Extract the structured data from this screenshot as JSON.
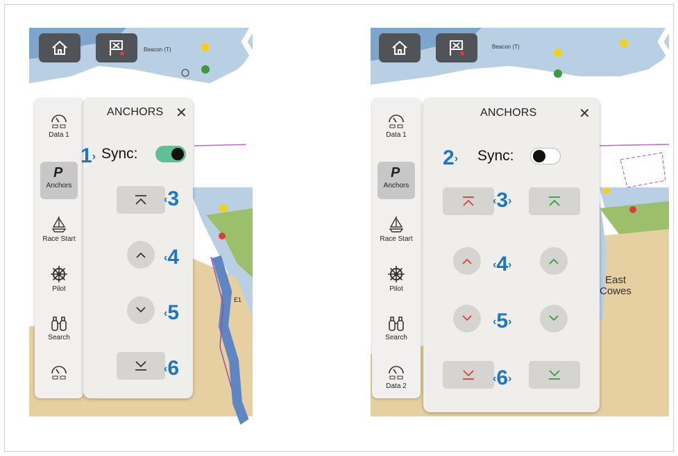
{
  "colors": {
    "callout": "#1b77c4",
    "toggle_on": "#5fc095",
    "port_red": "#e03a3a",
    "starboard_green": "#2f9e3a",
    "water": "#b9cfe4",
    "land": "#e6cfa0"
  },
  "left": {
    "sidebar": [
      {
        "label": "Data 1",
        "icon": "gauge-icon"
      },
      {
        "label": "Anchors",
        "icon": "anchor-p-icon",
        "active": true
      },
      {
        "label": "Race Start",
        "icon": "sailboat-icon"
      },
      {
        "label": "Pilot",
        "icon": "helm-wheel-icon"
      },
      {
        "label": "Search",
        "icon": "binoculars-icon"
      },
      {
        "label": "",
        "icon": "gauge-icon"
      }
    ],
    "panel": {
      "title": "ANCHORS",
      "close": "✕",
      "sync_label": "Sync:",
      "sync_on": true
    },
    "callouts": [
      "1",
      "3",
      "4",
      "5",
      "6"
    ]
  },
  "right": {
    "sidebar": [
      {
        "label": "Data 1",
        "icon": "gauge-icon"
      },
      {
        "label": "Anchors",
        "icon": "anchor-p-icon",
        "active": true
      },
      {
        "label": "Race Start",
        "icon": "sailboat-icon"
      },
      {
        "label": "Pilot",
        "icon": "helm-wheel-icon"
      },
      {
        "label": "Search",
        "icon": "binoculars-icon"
      },
      {
        "label": "Data 2",
        "icon": "gauge-icon"
      }
    ],
    "panel": {
      "title": "ANCHORS",
      "close": "✕",
      "sync_label": "Sync:",
      "sync_on": false
    },
    "callouts": [
      "2",
      "3",
      "4",
      "5",
      "6"
    ],
    "map_labels": {
      "place": "East",
      "place2": "Cowes"
    }
  },
  "map_text": {
    "beacon": "Beacon (T)",
    "e1": "E1"
  }
}
